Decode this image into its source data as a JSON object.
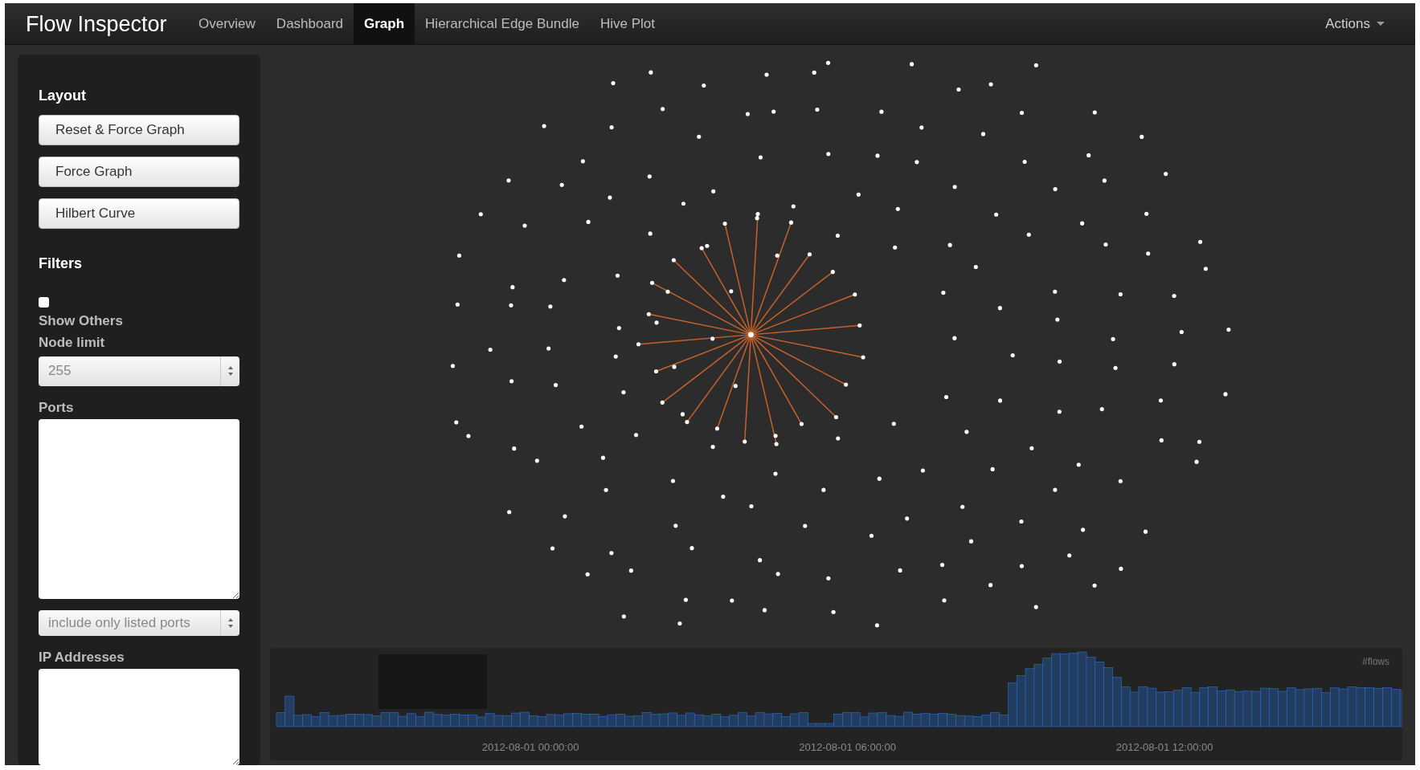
{
  "navbar": {
    "brand": "Flow Inspector",
    "items": [
      {
        "label": "Overview",
        "selected": false
      },
      {
        "label": "Dashboard",
        "selected": false
      },
      {
        "label": "Graph",
        "selected": true
      },
      {
        "label": "Hierarchical Edge Bundle",
        "selected": false
      },
      {
        "label": "Hive Plot",
        "selected": false
      }
    ],
    "actions": "Actions"
  },
  "sidebar": {
    "layout_heading": "Layout",
    "layout_buttons": [
      "Reset & Force Graph",
      "Force Graph",
      "Hilbert Curve"
    ],
    "filters_heading": "Filters",
    "show_others": {
      "label": "Show Others",
      "checked": false
    },
    "node_limit": {
      "label": "Node limit",
      "value": "255"
    },
    "ports": {
      "label": "Ports",
      "mode": "include only listed ports"
    },
    "ip_addresses": {
      "label": "IP Addresses"
    }
  },
  "timeline": {
    "measure": "#flows",
    "axis_labels": [
      "2012-08-01 00:00:00",
      "2012-08-01 06:00:00",
      "2012-08-01 12:00:00"
    ]
  }
}
